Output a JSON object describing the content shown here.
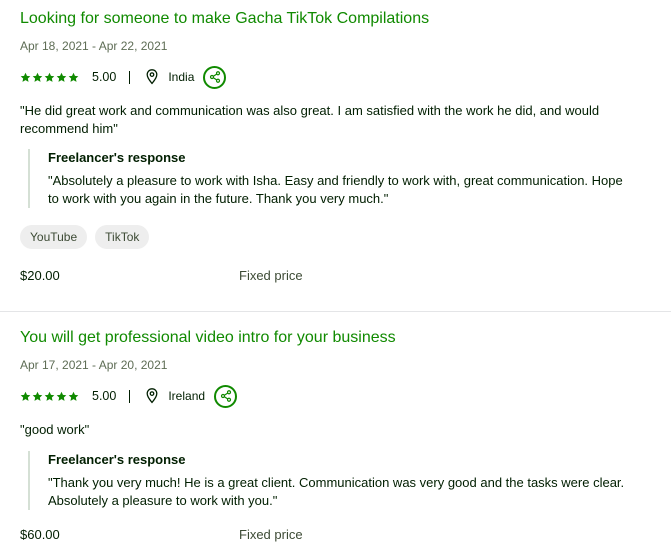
{
  "reviews": [
    {
      "title": "Looking for someone to make Gacha TikTok Compilations",
      "dates": "Apr 18, 2021 - Apr 22, 2021",
      "rating": 5,
      "score": "5.00",
      "country": "India",
      "comment": "\"He did great work and communication was also great. I am satisfied with the work he did, and would recommend him\"",
      "response_label": "Freelancer's response",
      "response_text": "\"Absolutely a pleasure to work with Isha. Easy and friendly to work with, great communication. Hope to work with you again in the future. Thank you very much.\"",
      "tags": [
        "YouTube",
        "TikTok"
      ],
      "price": "$20.00",
      "price_type": "Fixed price"
    },
    {
      "title": "You will get professional video intro for your business",
      "dates": "Apr 17, 2021 - Apr 20, 2021",
      "rating": 5,
      "score": "5.00",
      "country": "Ireland",
      "comment": "\"good work\"",
      "response_label": "Freelancer's response",
      "response_text": "\"Thank you very much! He is a great client. Communication was very good and the tasks were clear. Absolutely a pleasure to work with you.\"",
      "tags": [],
      "price": "$60.00",
      "price_type": "Fixed price"
    }
  ],
  "icons": {
    "star": "star-icon",
    "location": "location-pin-icon",
    "share": "share-icon"
  },
  "colors": {
    "accent": "#108a00",
    "text": "#001e00",
    "muted": "#5e6d55",
    "tag_bg": "#eeeeee"
  }
}
